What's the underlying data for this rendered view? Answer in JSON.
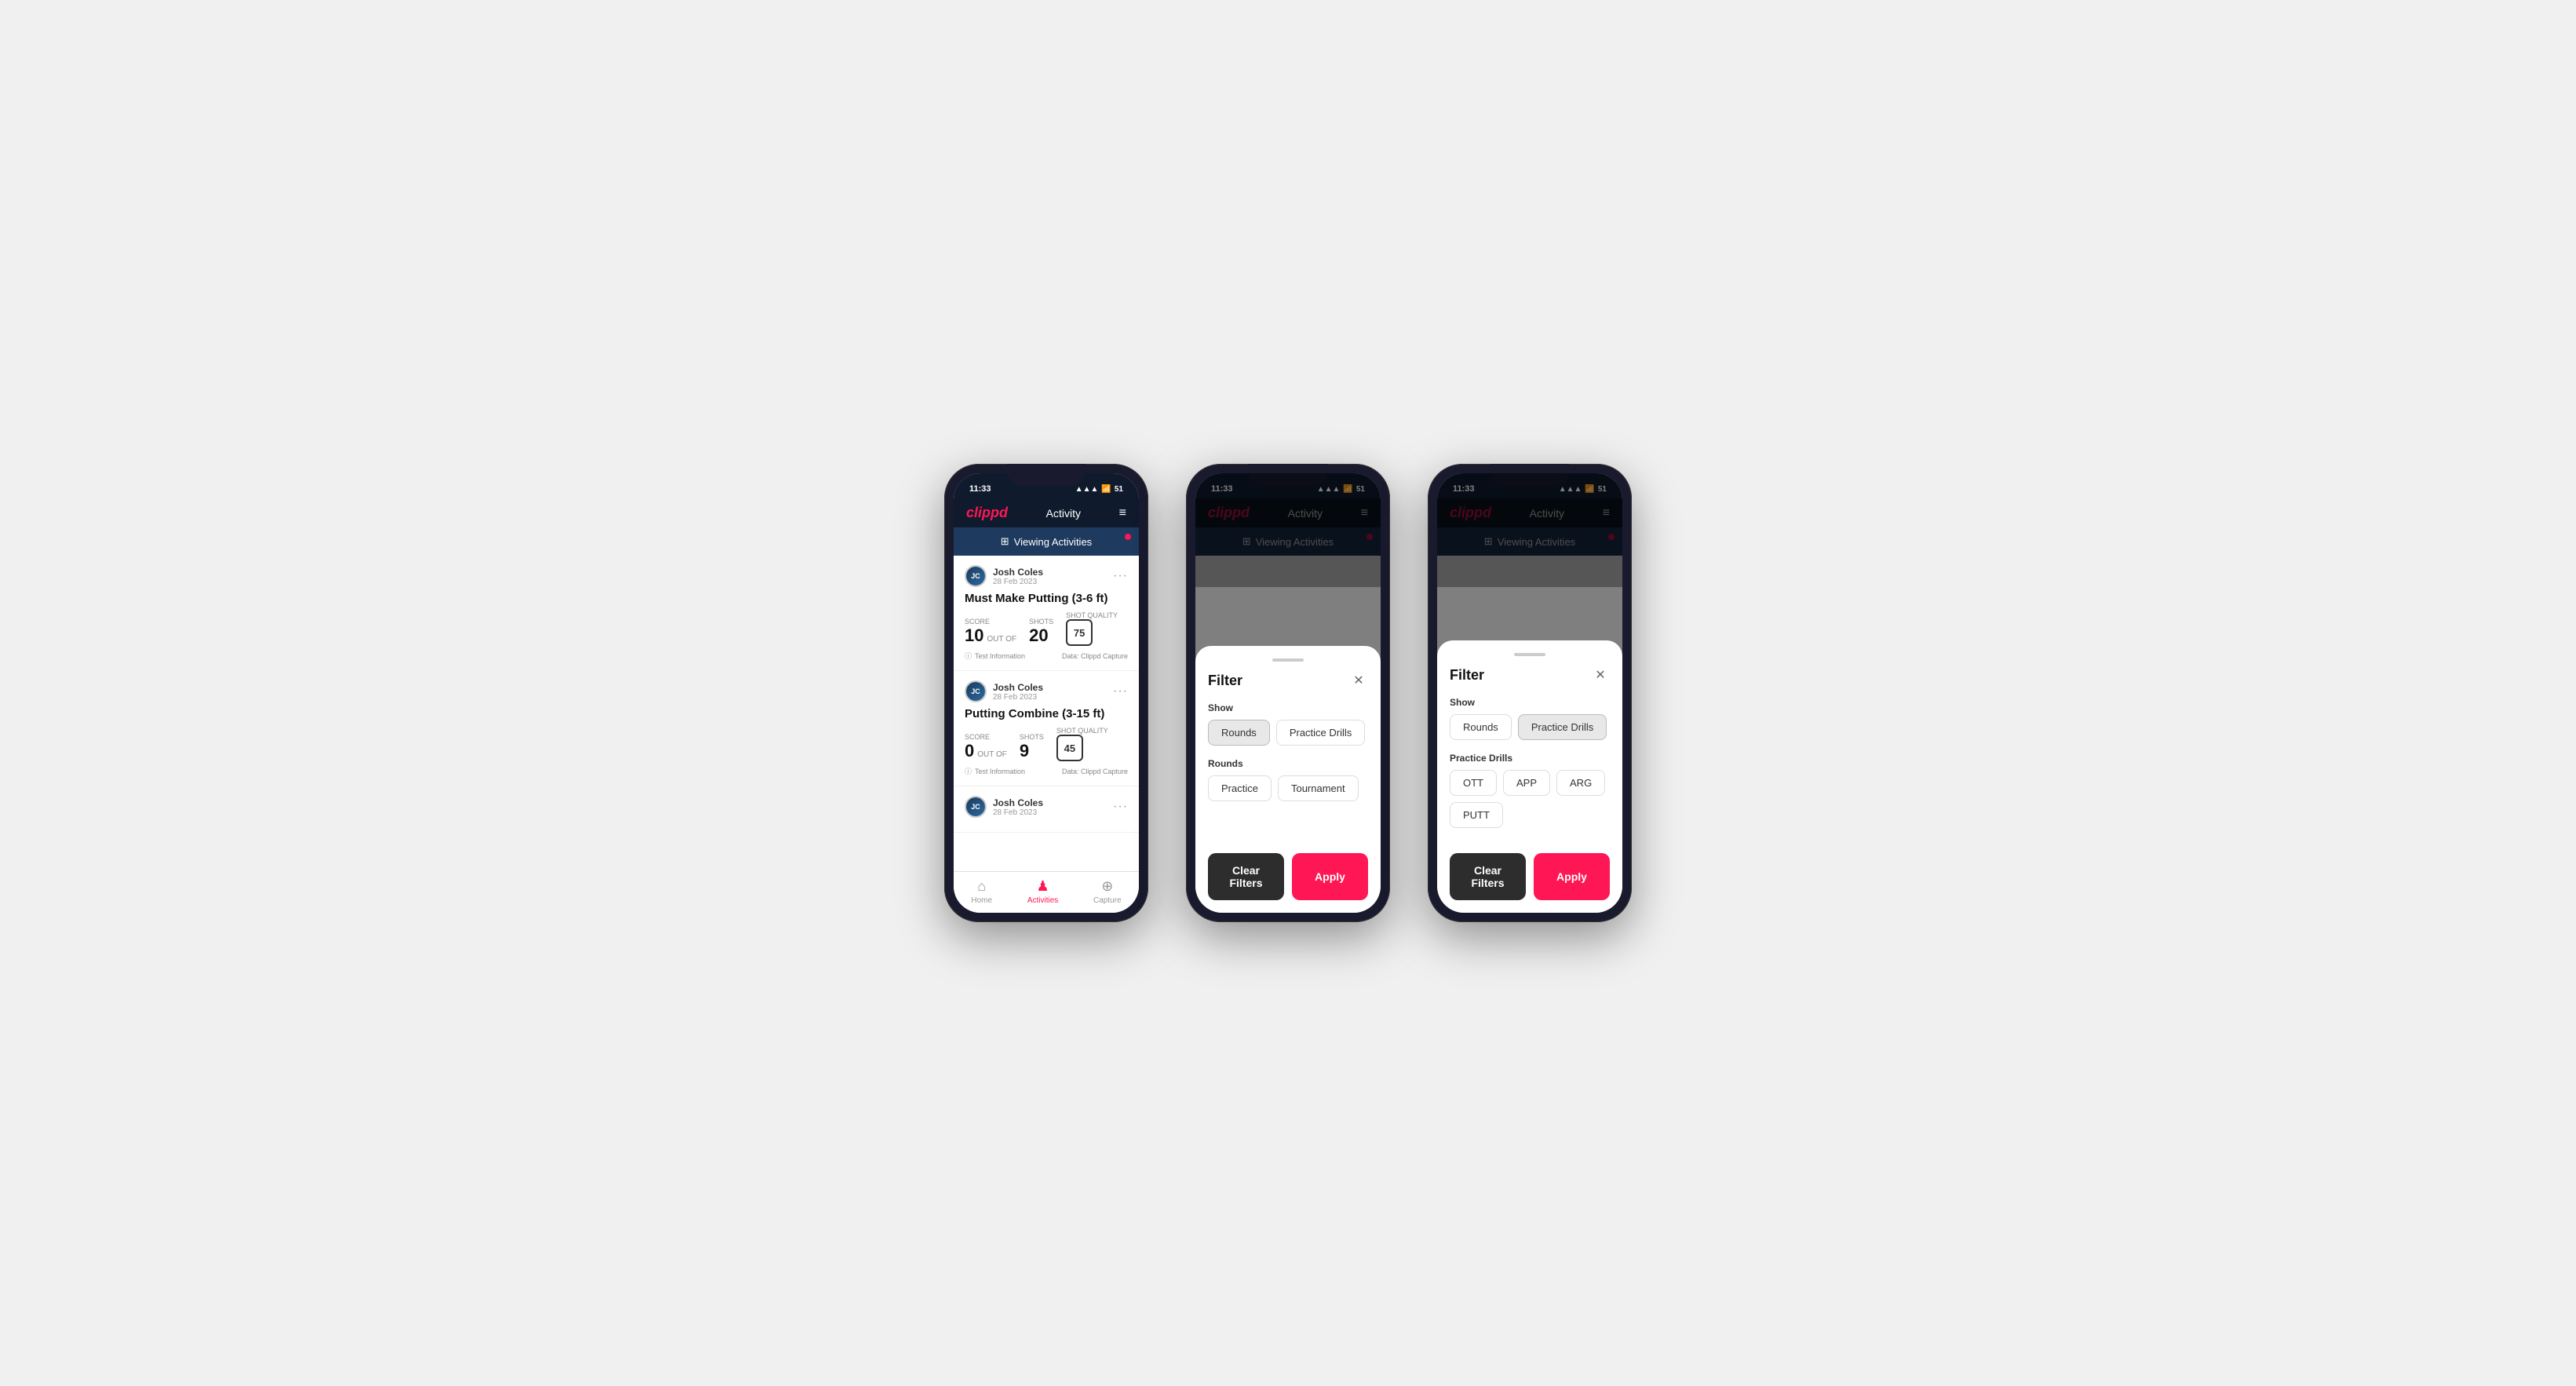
{
  "app": {
    "logo": "clippd",
    "header_title": "Activity",
    "time": "11:33",
    "battery": "51",
    "viewing_activities": "Viewing Activities"
  },
  "phone1": {
    "activities": [
      {
        "user_name": "Josh Coles",
        "user_date": "28 Feb 2023",
        "title": "Must Make Putting (3-6 ft)",
        "score_label": "Score",
        "score": "10",
        "out_of_label": "OUT OF",
        "shots_label": "Shots",
        "shots": "20",
        "shot_quality_label": "Shot Quality",
        "shot_quality": "75",
        "test_info": "Test Information",
        "data_source": "Data: Clippd Capture"
      },
      {
        "user_name": "Josh Coles",
        "user_date": "28 Feb 2023",
        "title": "Putting Combine (3-15 ft)",
        "score_label": "Score",
        "score": "0",
        "out_of_label": "OUT OF",
        "shots_label": "Shots",
        "shots": "9",
        "shot_quality_label": "Shot Quality",
        "shot_quality": "45",
        "test_info": "Test Information",
        "data_source": "Data: Clippd Capture"
      },
      {
        "user_name": "Josh Coles",
        "user_date": "28 Feb 2023",
        "title": "",
        "score_label": "",
        "score": "",
        "shots": "",
        "shot_quality": ""
      }
    ],
    "nav": {
      "home": "Home",
      "activities": "Activities",
      "capture": "Capture"
    }
  },
  "phone2": {
    "filter": {
      "title": "Filter",
      "show_label": "Show",
      "rounds_btn": "Rounds",
      "practice_drills_btn": "Practice Drills",
      "rounds_section_label": "Rounds",
      "practice_btn": "Practice",
      "tournament_btn": "Tournament",
      "clear_filters_btn": "Clear Filters",
      "apply_btn": "Apply"
    }
  },
  "phone3": {
    "filter": {
      "title": "Filter",
      "show_label": "Show",
      "rounds_btn": "Rounds",
      "practice_drills_btn": "Practice Drills",
      "practice_drills_section_label": "Practice Drills",
      "ott_btn": "OTT",
      "app_btn": "APP",
      "arg_btn": "ARG",
      "putt_btn": "PUTT",
      "clear_filters_btn": "Clear Filters",
      "apply_btn": "Apply"
    }
  }
}
